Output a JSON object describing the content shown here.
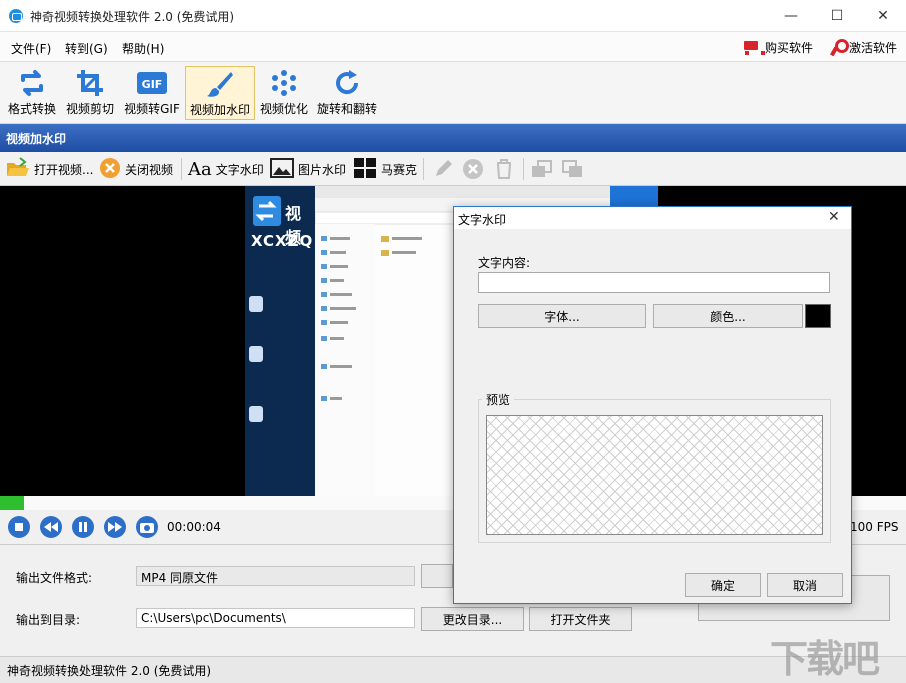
{
  "window": {
    "title": "神奇视频转换处理软件 2.0 (免费试用)",
    "minimize_glyph": "—",
    "maximize_glyph": "☐",
    "close_glyph": "✕"
  },
  "menu": {
    "file": "文件(F)",
    "goto": "转到(G)",
    "help": "帮助(H)",
    "buy": "购买软件",
    "activate": "激活软件"
  },
  "toolbar": {
    "items": [
      {
        "label": "格式转换",
        "icon": "convert-icon"
      },
      {
        "label": "视频剪切",
        "icon": "crop-icon"
      },
      {
        "label": "视频转GIF",
        "icon": "gif-icon"
      },
      {
        "label": "视频加水印",
        "icon": "brush-icon"
      },
      {
        "label": "视频优化",
        "icon": "optimize-icon"
      },
      {
        "label": "旋转和翻转",
        "icon": "rotate-icon"
      }
    ],
    "active_index": 3
  },
  "section": {
    "title": "视频加水印"
  },
  "subtoolbar": {
    "open_video": "打开视频...",
    "close_video": "关闭视频",
    "text_watermark": "文字水印",
    "image_watermark": "图片水印",
    "mosaic": "马赛克",
    "text_watermark_icon": "Aa"
  },
  "video": {
    "logo_text": "视频",
    "logo_sub": "XCXZQ"
  },
  "playback": {
    "time": "00:00:04",
    "fps": "100 FPS",
    "progress": 0.027
  },
  "output": {
    "format_label": "输出文件格式:",
    "format_value": "MP4 同原文件",
    "dir_label": "输出到目录:",
    "dir_value": "C:\\Users\\pc\\Documents\\",
    "change_dir": "更改目录...",
    "open_folder": "打开文件夹"
  },
  "statusbar": {
    "text": "神奇视频转换处理软件 2.0 (免费试用)"
  },
  "watermark": {
    "text": "下载吧"
  },
  "dialog": {
    "title": "文字水印",
    "content_label": "文字内容:",
    "content_value": "",
    "font_button": "字体...",
    "color_button": "颜色...",
    "color_value": "#000000",
    "preview_label": "预览",
    "ok": "确定",
    "cancel": "取消"
  },
  "colors": {
    "accent": "#1e4ea3",
    "progress": "#2ebf2e",
    "brand_red": "#d8232a",
    "icon_blue": "#2d7ad6"
  }
}
